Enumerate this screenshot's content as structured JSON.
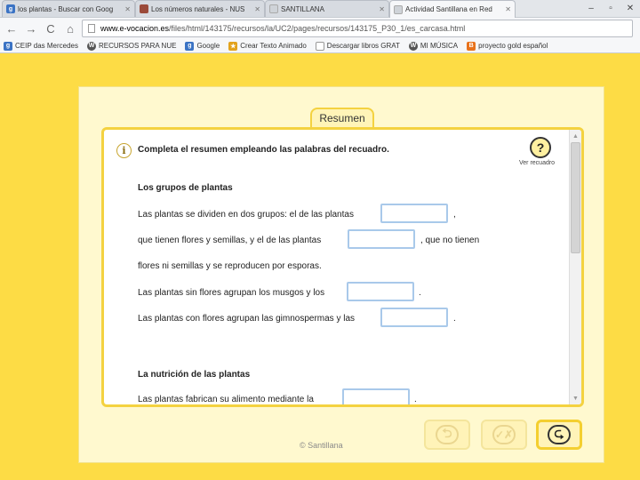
{
  "browser": {
    "tabs": [
      {
        "label": "los plantas - Buscar con Goog",
        "favicon": "google-favicon",
        "color": "#3b73c4",
        "letter": "g"
      },
      {
        "label": "Los números naturales - NUS",
        "favicon": "user-favicon",
        "color": "#9b4a3a",
        "letter": ""
      },
      {
        "label": "SANTILLANA",
        "favicon": "page-favicon",
        "color": "#cfd3d8",
        "letter": ""
      },
      {
        "label": "Actividad Santillana en Red",
        "favicon": "page-favicon",
        "color": "#cfd3d8",
        "letter": ""
      }
    ],
    "window_controls": [
      "–",
      "▫",
      "✕"
    ],
    "nav": {
      "back": "←",
      "forward": "→",
      "reload": "C",
      "home": "⌂"
    },
    "url_host": "www.e-vocacion.es",
    "url_path": "/files/html/143175/recursos/la/UC2/pages/recursos/143175_P30_1/es_carcasa.html",
    "bookmarks": [
      {
        "label": "CEIP das Mercedes",
        "icon": "google-icon",
        "color": "#3b73c4",
        "letter": "g"
      },
      {
        "label": "RECURSOS PARA NUE",
        "icon": "wordpress-icon",
        "color": "#555",
        "letter": "W"
      },
      {
        "label": "Google",
        "icon": "google-icon",
        "color": "#3b73c4",
        "letter": "g"
      },
      {
        "label": "Crear Texto Animado",
        "icon": "star-icon",
        "color": "#e2a21c",
        "letter": "★"
      },
      {
        "label": "Descargar libros GRAT",
        "icon": "page-icon",
        "color": "#999",
        "letter": ""
      },
      {
        "label": "MI MÚSICA",
        "icon": "wordpress-icon",
        "color": "#555",
        "letter": "W"
      },
      {
        "label": "proyecto gold español",
        "icon": "blogger-icon",
        "color": "#e8721c",
        "letter": "B"
      }
    ]
  },
  "activity": {
    "title": "Resumen",
    "instruction": "Completa el resumen empleando las palabras del recuadro.",
    "help_label": "Ver recuadro",
    "help_symbol": "?",
    "info_symbol": "i",
    "section1_heading": "Los grupos de plantas",
    "section1_lines": [
      {
        "before": "Las plantas se dividen en dos grupos: el de las plantas",
        "after": ","
      },
      {
        "before": "que tienen flores y semillas, y el de las plantas",
        "after": ", que no tienen"
      },
      {
        "before": "flores ni semillas y se reproducen por esporas.",
        "after": ""
      },
      {
        "before": "Las plantas sin flores agrupan los musgos y los",
        "after": "."
      },
      {
        "before": "Las plantas con flores agrupan las gimnospermas y las",
        "after": "."
      }
    ],
    "section2_heading": "La nutrición de las plantas",
    "section2_lines": [
      {
        "before": "Las plantas fabrican su alimento mediante la",
        "after": "."
      }
    ],
    "copyright": "© Santillana",
    "buttons": {
      "back_symbol": "⮌",
      "check_symbol": "✓✗",
      "next_symbol": "⮎"
    }
  }
}
